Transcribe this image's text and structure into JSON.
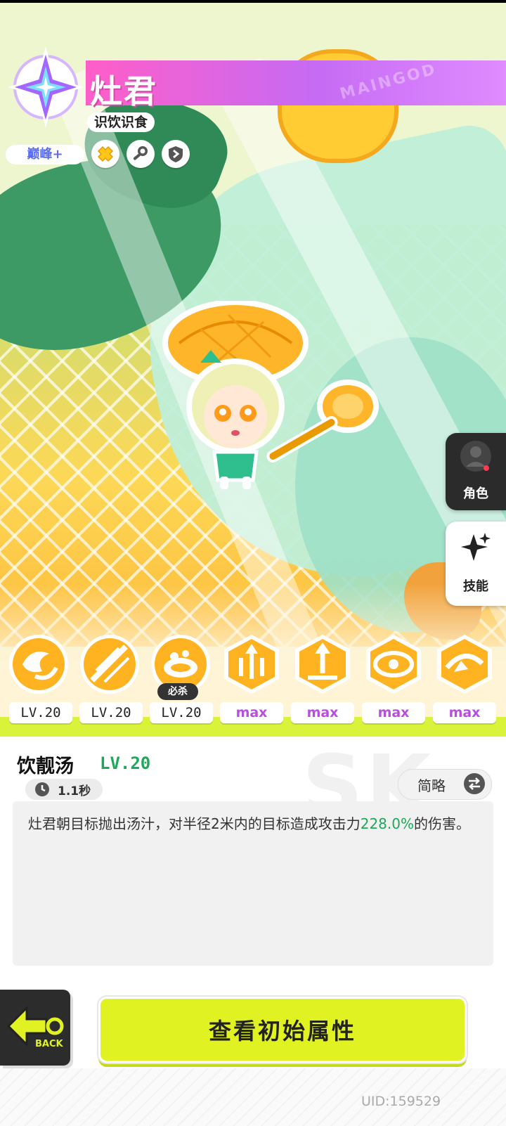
{
  "character": {
    "name": "灶君",
    "title": "识饮识食",
    "rank": "巅峰+",
    "banner_text": "MAINGOD"
  },
  "side_tabs": [
    {
      "label": "角色",
      "icon": "person-icon",
      "active": false
    },
    {
      "label": "技能",
      "icon": "sparkle-star-icon",
      "active": true
    }
  ],
  "skills": [
    {
      "icon": "swirl-wind-icon",
      "level": "LV.20"
    },
    {
      "icon": "slash-strike-icon",
      "level": "LV.20"
    },
    {
      "icon": "soup-bowl-icon",
      "level": "LV.20",
      "tag": "必杀"
    },
    {
      "icon": "triple-arrow-icon",
      "level": "max"
    },
    {
      "icon": "upward-burst-icon",
      "level": "max"
    },
    {
      "icon": "vortex-icon",
      "level": "max"
    },
    {
      "icon": "spin-slash-icon",
      "level": "max"
    }
  ],
  "detail": {
    "skill_name": "饮靓汤",
    "skill_level": "LV.20",
    "cooldown": "1.1秒",
    "toggle_label": "简略",
    "description_before": "灶君朝目标抛出汤汁，对半径2米内的目标造成攻击力",
    "description_highlight": "228.0%",
    "description_after": "的伤害。"
  },
  "buttons": {
    "back_label": "BACK",
    "view_attributes": "查看初始属性"
  },
  "footer": {
    "uid": "UID:159529"
  },
  "colors": {
    "accent_lime": "#e0f222",
    "highlight_green": "#1fa85a",
    "max_purple": "#b84ee0",
    "banner_pink": "#ff5ec8"
  }
}
